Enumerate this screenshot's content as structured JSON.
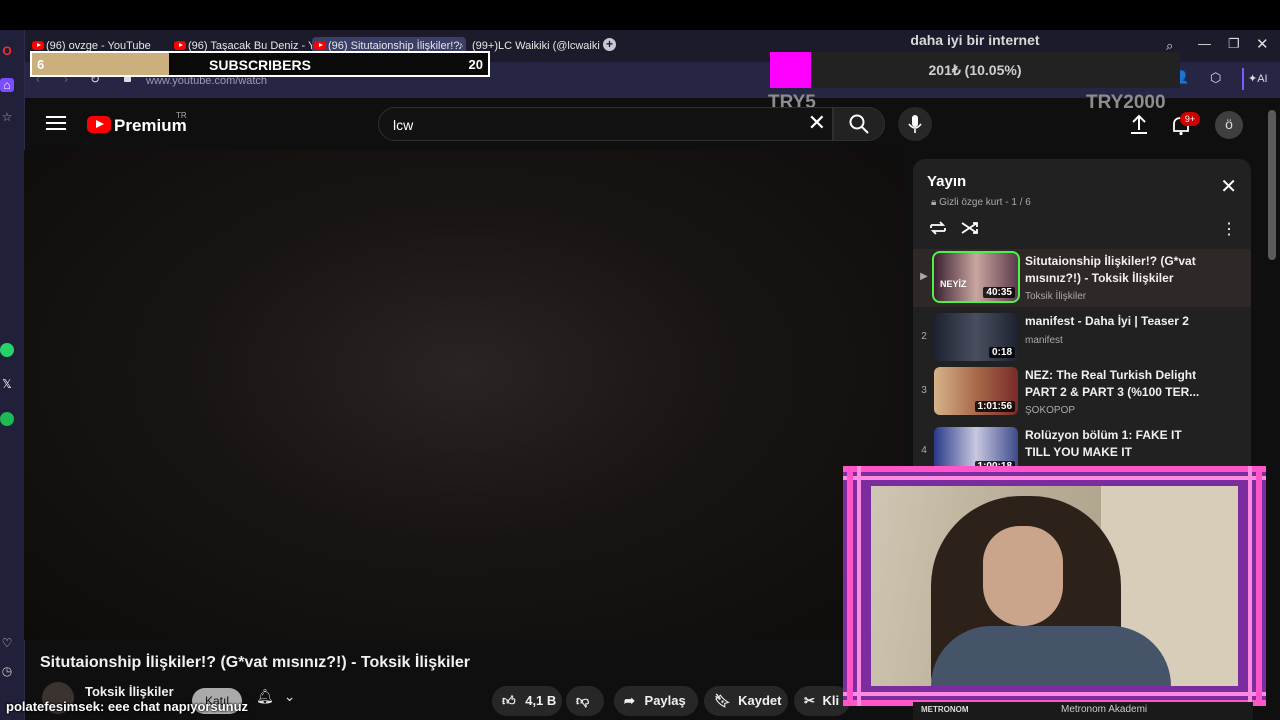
{
  "browser": {
    "tabs": [
      {
        "label": "(96) ovzge - YouTube",
        "type": "youtube"
      },
      {
        "label": "(96) Taşacak Bu Deniz - Yo",
        "type": "youtube"
      },
      {
        "label": "(96) Situtaionship İlişkiler!?",
        "type": "youtube",
        "active": true
      },
      {
        "label": "(99+)LC Waikiki (@lcwaiki",
        "type": "tiktok"
      }
    ],
    "new_tab": "+",
    "url": "www.youtube.com/watch",
    "ai_label": "AI"
  },
  "subs_overlay": {
    "current": "6",
    "label": "SUBSCRIBERS",
    "goal": "20",
    "progress_fraction": 0.3
  },
  "internet_overlay": {
    "title": "daha iyi bir internet",
    "amount": "201₺ (10.05%)",
    "progress_fraction": 0.1005,
    "min_label": "TRY5",
    "max_label": "TRY2000"
  },
  "youtube": {
    "brand": "Premium",
    "region": "TR",
    "search_value": "lcw",
    "notif_badge": "9+",
    "avatar_letter": "ö"
  },
  "video": {
    "title": "Situtaionship İlişkiler!? (G*vat mısınız?!) - Toksik İlişkiler",
    "channel": "Toksik İlişkiler",
    "join_label": "Katıl",
    "likes": "4,1 B",
    "share_label": "Paylaş",
    "save_label": "Kaydet",
    "clip_label": "Kli"
  },
  "playlist": {
    "title": "Yayın",
    "subtitle": "Gizli özge kurt - 1 / 6",
    "items": [
      {
        "index": "▶",
        "title": "Situtaionship İlişkiler!? (G*vat mısınız?!) - Toksik İlişkiler",
        "channel": "Toksik İlişkiler",
        "duration": "40:35",
        "thumb_color": "#5a3a4a",
        "thumb_text": "NEYİZ"
      },
      {
        "index": "2",
        "title": "manifest - Daha İyi | Teaser 2",
        "channel": "manifest",
        "duration": "0:18",
        "thumb_color": "#2c3140"
      },
      {
        "index": "3",
        "title": "NEZ: The Real Turkish Delight PART 2 & PART 3 (%100 TER...",
        "channel": "ŞOKOPOP",
        "duration": "1:01:56",
        "thumb_color": "#a86a4a"
      },
      {
        "index": "4",
        "title": "Rolüzyon bölüm 1: FAKE IT TILL YOU MAKE IT",
        "channel": "",
        "duration": "1:00:18",
        "thumb_color": "#3c4a8a"
      }
    ]
  },
  "chat": {
    "user": "polatefesimsek",
    "message": ": eee chat napıyorsunuz"
  },
  "bottom_ad": {
    "brand": "METRONOM",
    "text": "Metronom Akademi"
  },
  "colors": {
    "youtube_red": "#ff0000",
    "overlay_magenta": "#ff00ff",
    "cam_frame": "#7b2da0",
    "subs_fill": "#cbaf7c"
  }
}
